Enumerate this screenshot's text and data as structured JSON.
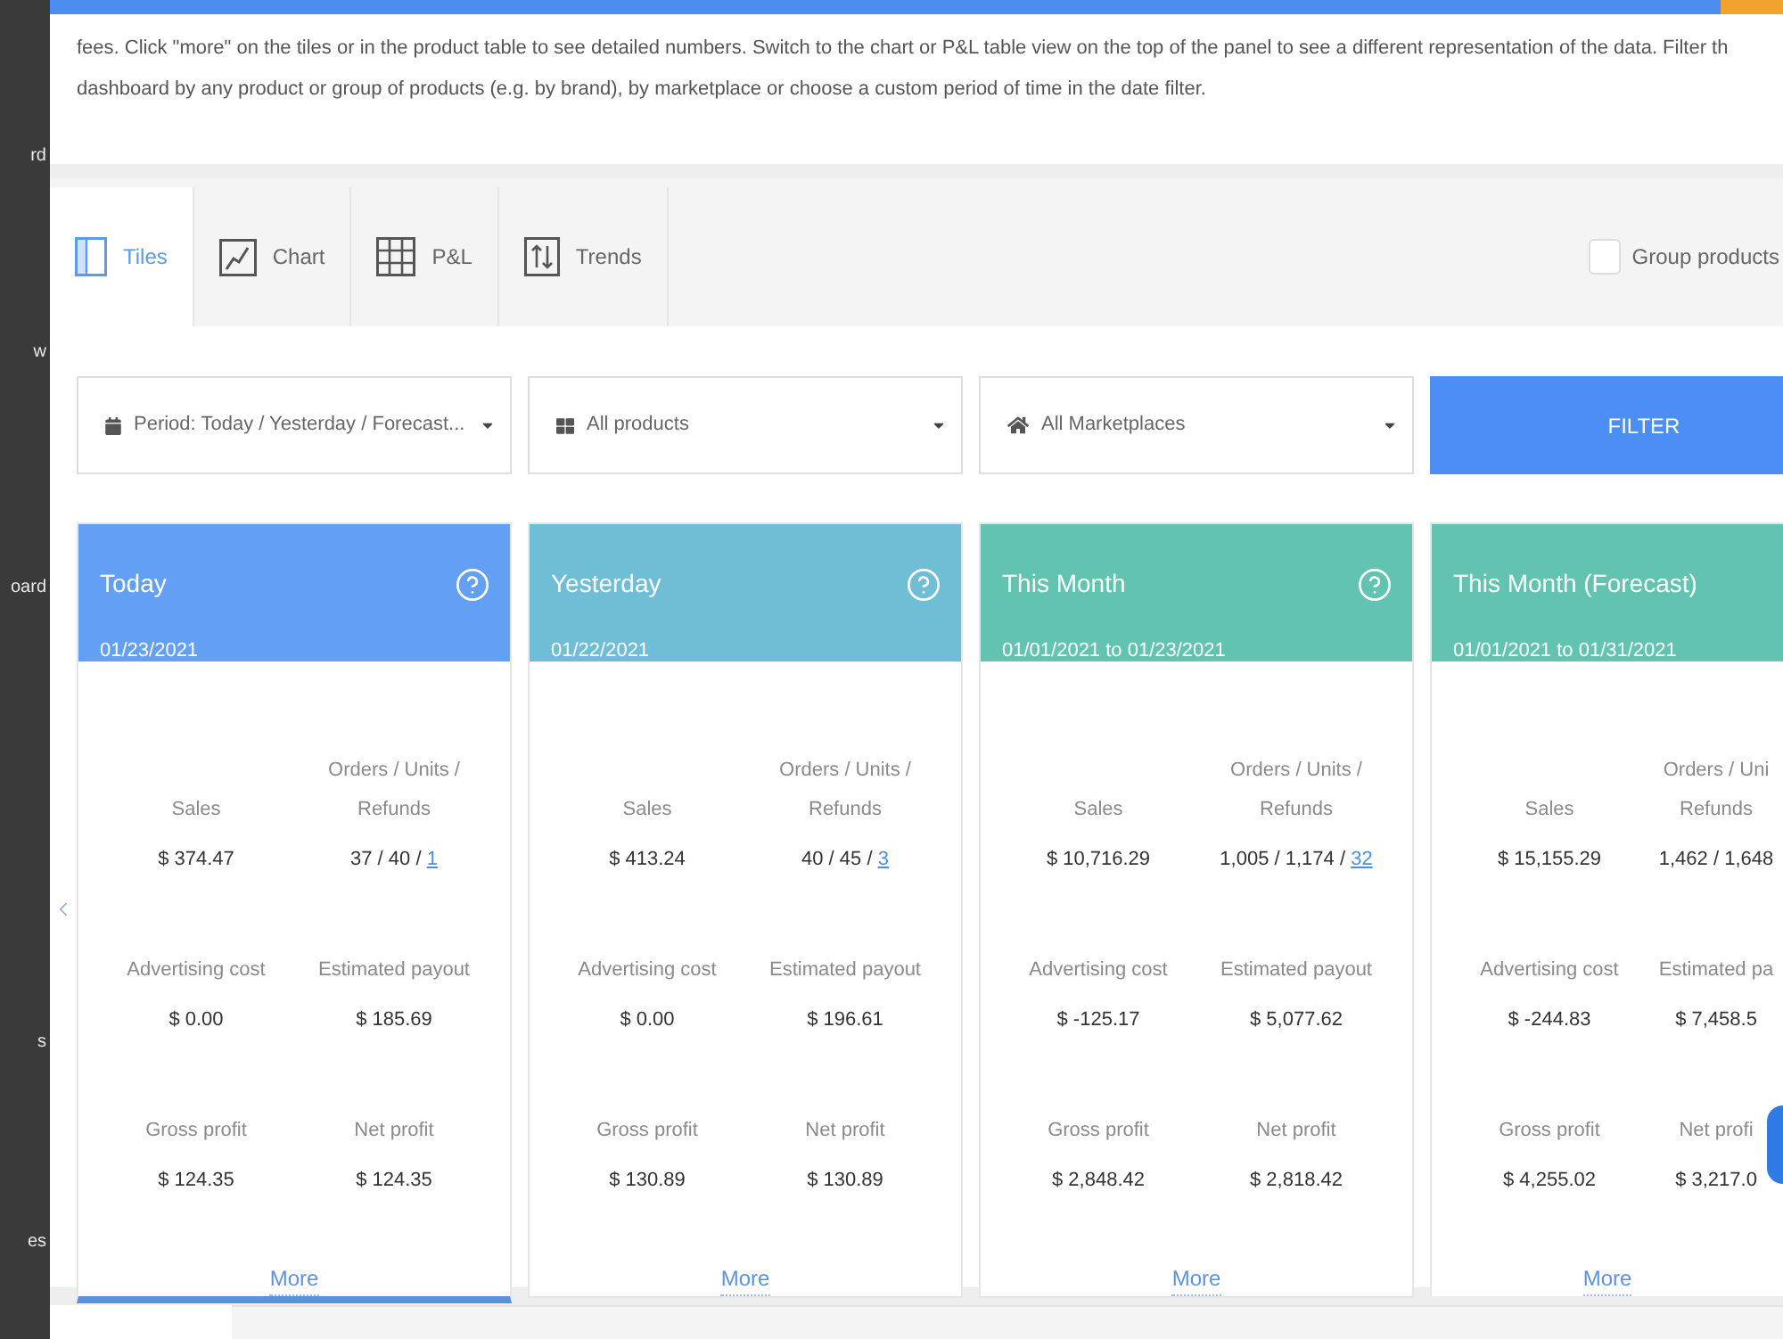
{
  "sidebar": {
    "items": [
      {
        "label": "rd"
      },
      {
        "label": "w"
      },
      {
        "label": "oard"
      },
      {
        "label": "s"
      },
      {
        "label": "es"
      }
    ]
  },
  "help_text": {
    "lines": [
      "fees. Click \"more\" on the tiles or in the product table to see detailed numbers. Switch to the chart or P&L table view on the top of the panel to see a different representation of the data. Filter th",
      "dashboard by any product or group of products (e.g. by brand), by marketplace or choose a custom period of time in the date filter."
    ]
  },
  "view_tabs": [
    {
      "kind": "tiles",
      "label": "Tiles",
      "selected": true
    },
    {
      "kind": "chart",
      "label": "Chart",
      "selected": false
    },
    {
      "kind": "table",
      "label": "P&L",
      "selected": false
    },
    {
      "kind": "trends",
      "label": "Trends",
      "selected": false
    }
  ],
  "group_products": {
    "label": "Group products",
    "checked": false
  },
  "filters": [
    {
      "kind": "period",
      "label": "Period: Today / Yesterday / Forecast..."
    },
    {
      "kind": "products",
      "label": "All products"
    },
    {
      "kind": "marketplaces",
      "label": "All Marketplaces"
    }
  ],
  "filter_button": {
    "label": "FILTER"
  },
  "tiles": [
    {
      "title": "Today",
      "date": "01/23/2021",
      "color": "#63a0f4",
      "help_icon": true,
      "selected": true,
      "metrics": [
        {
          "label": "Sales",
          "value": "$ 374.47"
        },
        {
          "label": "Advertising cost",
          "value": "$ 0.00"
        },
        {
          "label": "Gross profit",
          "value": "$ 124.35"
        },
        {
          "label": "Orders / Units /\nRefunds",
          "value": "37 / 40 /",
          "link": "1"
        },
        {
          "label": "Estimated payout",
          "value": "$ 185.69"
        },
        {
          "label": "Net profit",
          "value": "$ 124.35"
        }
      ],
      "more": "More"
    },
    {
      "title": "Yesterday",
      "date": "01/22/2021",
      "color": "#70bdd6",
      "help_icon": true,
      "selected": false,
      "metrics": [
        {
          "label": "Sales",
          "value": "$ 413.24"
        },
        {
          "label": "Advertising cost",
          "value": "$ 0.00"
        },
        {
          "label": "Gross profit",
          "value": "$ 130.89"
        },
        {
          "label": "Orders / Units /\nRefunds",
          "value": "40 / 45 /",
          "link": "3"
        },
        {
          "label": "Estimated payout",
          "value": "$ 196.61"
        },
        {
          "label": "Net profit",
          "value": "$ 130.89"
        }
      ],
      "more": "More"
    },
    {
      "title": "This Month",
      "date": "01/01/2021 to 01/23/2021",
      "color": "#62c4b0",
      "help_icon": true,
      "selected": false,
      "metrics": [
        {
          "label": "Sales",
          "value": "$ 10,716.29"
        },
        {
          "label": "Advertising cost",
          "value": "$ -125.17"
        },
        {
          "label": "Gross profit",
          "value": "$ 2,848.42"
        },
        {
          "label": "Orders / Units /\nRefunds",
          "value": "1,005 / 1,174 /",
          "link": "32"
        },
        {
          "label": "Estimated payout",
          "value": "$ 5,077.62"
        },
        {
          "label": "Net profit",
          "value": "$ 2,818.42"
        }
      ],
      "more": "More"
    },
    {
      "title": "This Month (Forecast)",
      "date": "01/01/2021 to 01/31/2021",
      "color": "#62c4b0",
      "help_icon": false,
      "selected": false,
      "metrics": [
        {
          "label": "Sales",
          "value": "$ 15,155.29"
        },
        {
          "label": "Advertising cost",
          "value": "$ -244.83"
        },
        {
          "label": "Gross profit",
          "value": "$ 4,255.02"
        },
        {
          "label": "Orders / Uni\nRefunds",
          "value": "1,462 / 1,648"
        },
        {
          "label": "Estimated pa",
          "value": "$ 7,458.5"
        },
        {
          "label": "Net profi",
          "value": "$ 3,217.0"
        }
      ],
      "more": "More"
    }
  ]
}
